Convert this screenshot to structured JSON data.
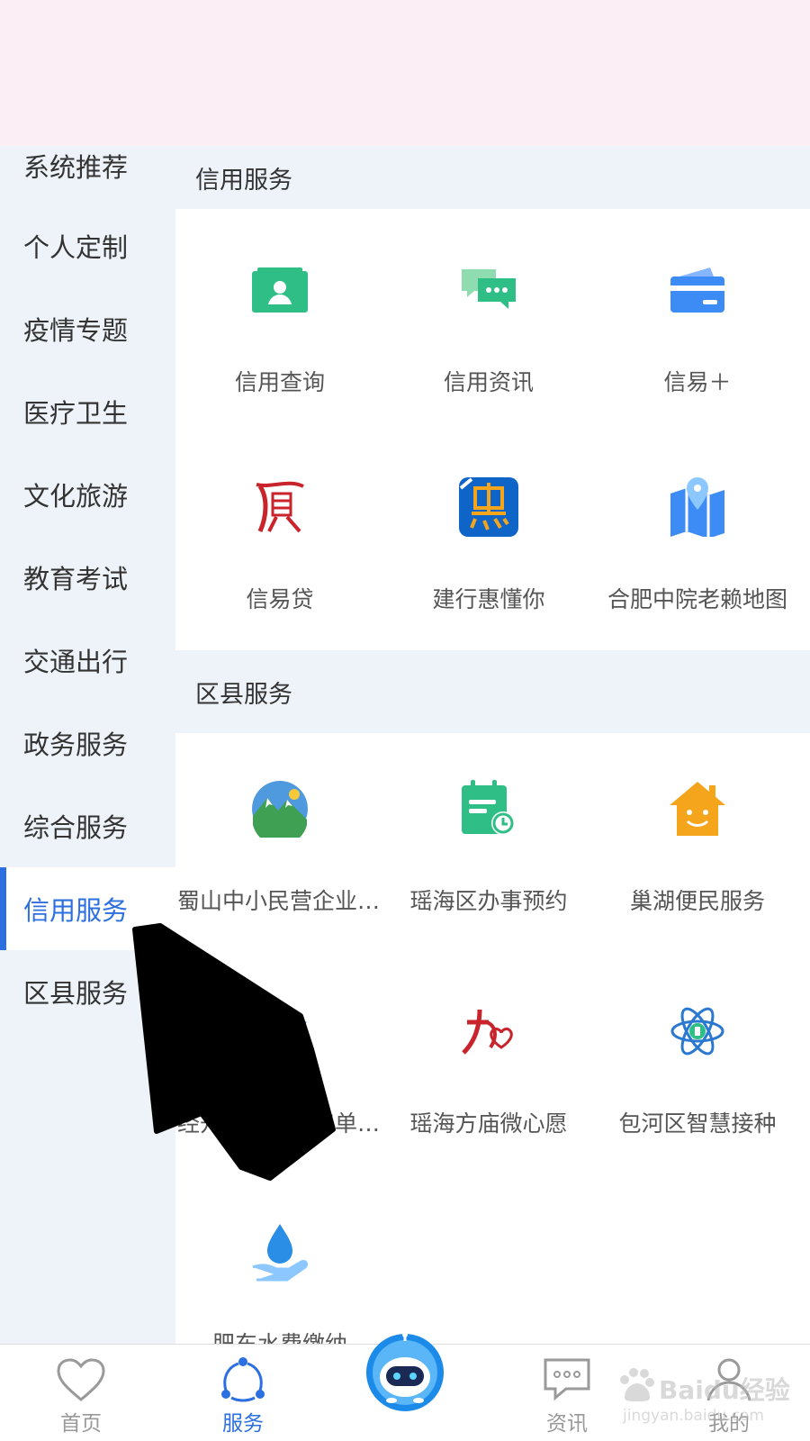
{
  "sidebar": {
    "items": [
      {
        "label": "系统推荐"
      },
      {
        "label": "个人定制"
      },
      {
        "label": "疫情专题"
      },
      {
        "label": "医疗卫生"
      },
      {
        "label": "文化旅游"
      },
      {
        "label": "教育考试"
      },
      {
        "label": "交通出行"
      },
      {
        "label": "政务服务"
      },
      {
        "label": "综合服务"
      },
      {
        "label": "信用服务",
        "active": true
      },
      {
        "label": "区县服务"
      }
    ]
  },
  "sections": [
    {
      "title": "信用服务",
      "tiles": [
        {
          "label": "信用查询",
          "icon": "id-card-icon"
        },
        {
          "label": "信用资讯",
          "icon": "chat-bubbles-icon"
        },
        {
          "label": "信易＋",
          "icon": "cards-icon"
        },
        {
          "label": "信易贷",
          "icon": "xin-yi-dai-logo-icon"
        },
        {
          "label": "建行惠懂你",
          "icon": "hui-logo-icon"
        },
        {
          "label": "合肥中院老赖地图",
          "icon": "map-pin-icon"
        }
      ]
    },
    {
      "title": "区县服务",
      "tiles": [
        {
          "label": "蜀山中小民营企业服务平台",
          "icon": "mountain-icon"
        },
        {
          "label": "瑶海区办事预约",
          "icon": "calendar-clock-icon"
        },
        {
          "label": "巢湖便民服务",
          "icon": "smiling-house-icon"
        },
        {
          "label": "经开区企业用工单位服务",
          "icon": "graduation-cap-icon"
        },
        {
          "label": "瑶海方庙微心愿",
          "icon": "heart-wish-icon"
        },
        {
          "label": "包河区智慧接种",
          "icon": "atom-icon"
        },
        {
          "label": "肥东水费缴纳",
          "icon": "water-drop-hand-icon"
        }
      ]
    }
  ],
  "bottom_nav": {
    "items": [
      {
        "label": "首页",
        "icon": "heart-icon"
      },
      {
        "label": "服务",
        "icon": "share-nodes-icon",
        "active": true
      },
      {
        "label": "",
        "icon": "robot-assistant-icon"
      },
      {
        "label": "资讯",
        "icon": "message-icon"
      },
      {
        "label": "我的",
        "icon": "user-icon"
      }
    ]
  },
  "watermark": {
    "text": "Baidu经验",
    "sub": "jingyan.baidu.com"
  },
  "colors": {
    "accent": "#2b6fe0",
    "sidebar_bg": "#eef3f9",
    "top_band": "#fbeef4"
  }
}
